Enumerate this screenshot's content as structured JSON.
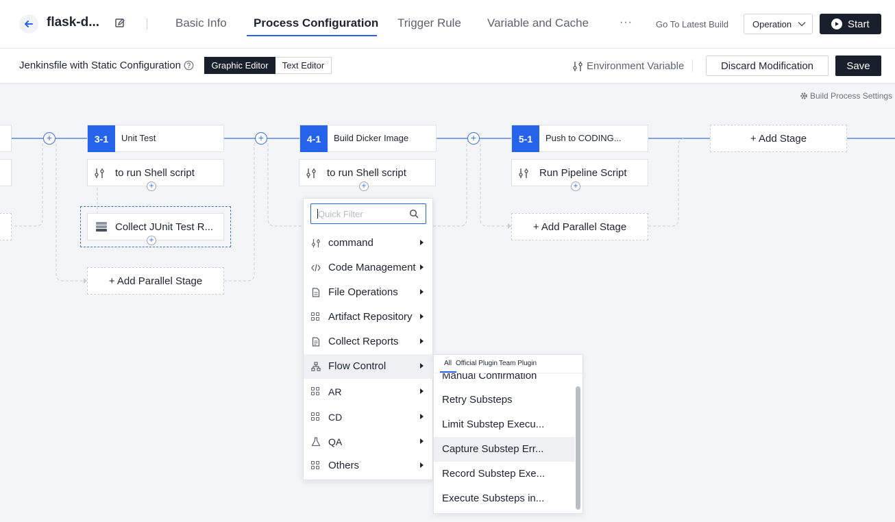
{
  "header": {
    "project_title": "flask-d...",
    "tabs": [
      {
        "label": "Basic Info"
      },
      {
        "label": "Process Configuration"
      },
      {
        "label": "Trigger Rule"
      },
      {
        "label": "Variable and Cache"
      }
    ],
    "more": "···",
    "latest_build": "Go To Latest Build",
    "operation": "Operation",
    "start": "Start"
  },
  "toolbar": {
    "jenkinsfile_label": "Jenkinsfile with Static Configuration",
    "graphic_editor": "Graphic Editor",
    "text_editor": "Text Editor",
    "env_variable": "Environment Variable",
    "discard": "Discard Modification",
    "save": "Save"
  },
  "canvas": {
    "build_process_settings": "Build Process Settings",
    "stages": [
      {
        "number": "3-1",
        "name": "Unit Test",
        "steps": [
          "to run Shell script",
          "Collect JUnit Test R..."
        ],
        "add_parallel": "+ Add Parallel Stage"
      },
      {
        "number": "4-1",
        "name": "Build Dicker Image",
        "steps": [
          "to run Shell script"
        ]
      },
      {
        "number": "5-1",
        "name": "Push to CODING...",
        "steps": [
          "Run Pipeline Script"
        ],
        "add_parallel": "+ Add Parallel Stage"
      }
    ],
    "add_stage": "+ Add Stage"
  },
  "menu": {
    "filter_placeholder": "Quick Filter",
    "items": [
      {
        "label": "command",
        "icon": "command-icon"
      },
      {
        "label": "Code Management",
        "icon": "code-icon"
      },
      {
        "label": "File Operations",
        "icon": "file-icon"
      },
      {
        "label": "Artifact Repository",
        "icon": "grid-icon"
      },
      {
        "label": "Collect Reports",
        "icon": "report-icon"
      },
      {
        "label": "Flow Control",
        "icon": "flow-icon"
      },
      {
        "label": "AR",
        "icon": "grid-icon"
      },
      {
        "label": "CD",
        "icon": "grid-icon"
      },
      {
        "label": "QA",
        "icon": "flask-icon"
      },
      {
        "label": "Others",
        "icon": "grid-icon"
      }
    ]
  },
  "submenu": {
    "tabs": [
      "All",
      "Official Plugin",
      "Team Plugin"
    ],
    "items": [
      {
        "label": "Manual Confirmation"
      },
      {
        "label": "Retry Substeps"
      },
      {
        "label": "Limit Substep Execu..."
      },
      {
        "label": "Capture Substep Err..."
      },
      {
        "label": "Record Substep Exe..."
      },
      {
        "label": "Execute Substeps in..."
      }
    ]
  },
  "colors": {
    "accent": "#2563eb",
    "dark_button": "#1a1f2c",
    "canvas_bg": "#f4f5f7"
  }
}
